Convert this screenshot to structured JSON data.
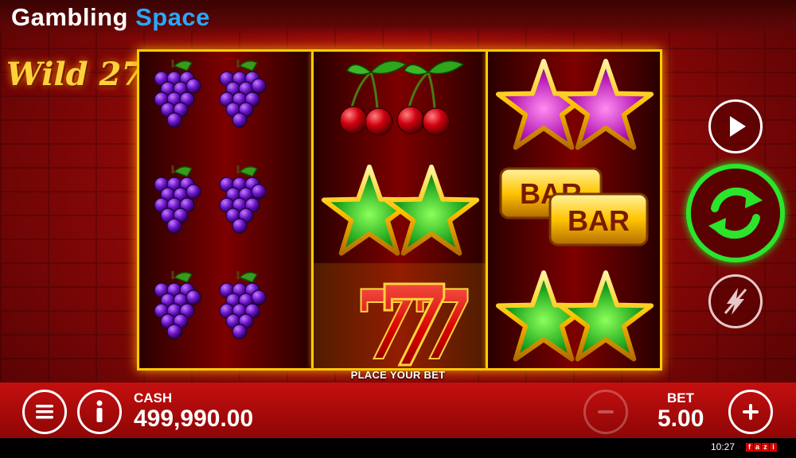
{
  "brand": {
    "part1": "Gambling",
    "part2": "Space"
  },
  "game": {
    "logo_text": "Wild 27"
  },
  "reels": [
    [
      "grapes",
      "grapes",
      "grapes"
    ],
    [
      "cherries",
      "green-star",
      "seven"
    ],
    [
      "purple-star",
      "bar",
      "green-star"
    ]
  ],
  "symbols": {
    "bar_text": "BAR",
    "seven_text": "7"
  },
  "status": {
    "message": "PLACE YOUR BET"
  },
  "wallet": {
    "cash_label": "CASH",
    "cash_value": "499,990.00"
  },
  "bet": {
    "label": "BET",
    "value": "5.00"
  },
  "footer": {
    "time": "10:27",
    "provider_letters": [
      "f",
      "a",
      "z",
      "i"
    ]
  },
  "colors": {
    "accent_gold": "#ffcc00",
    "spin_green": "#2ae52a",
    "brand_blue": "#2aa7ff",
    "background_red": "#b80f0f"
  }
}
